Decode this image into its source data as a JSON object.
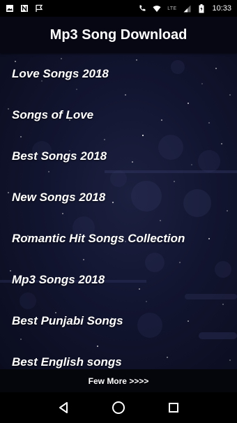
{
  "status_bar": {
    "time": "10:33",
    "network": "LTE",
    "left_icons": [
      "image-icon",
      "n-app-icon",
      "flag-icon"
    ],
    "right_icons": [
      "wifi-call-icon",
      "wifi-icon",
      "signal-icon",
      "battery-icon"
    ]
  },
  "app_bar": {
    "title": "Mp3 Song Download",
    "background": "#070713"
  },
  "menu": {
    "items": [
      {
        "label": "Love Songs 2018"
      },
      {
        "label": "Songs of Love"
      },
      {
        "label": "Best Songs 2018"
      },
      {
        "label": "New Songs 2018"
      },
      {
        "label": "Romantic Hit Songs Collection"
      },
      {
        "label": "Mp3 Songs 2018"
      },
      {
        "label": "Best Punjabi Songs"
      },
      {
        "label": "Best English songs"
      }
    ]
  },
  "footer": {
    "more_label": "Few More >>>>"
  },
  "nav_bar": {
    "buttons": [
      "back-icon",
      "home-icon",
      "recents-icon"
    ]
  },
  "colors": {
    "background_dark": "#0a0c1e",
    "background_mid": "#1c2040",
    "text": "#ffffff"
  }
}
